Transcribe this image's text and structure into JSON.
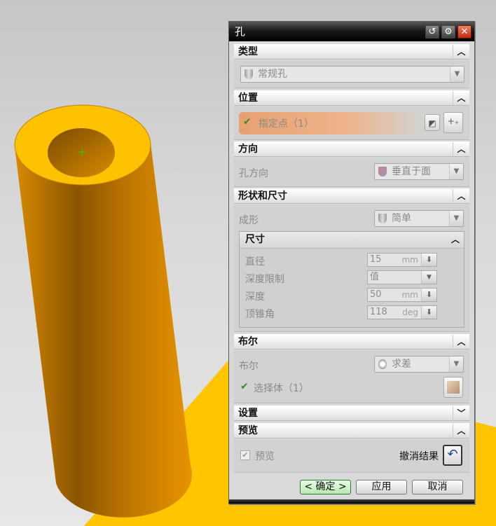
{
  "dialog": {
    "title": "孔",
    "title_buttons": {
      "reset_icon": "reset-icon",
      "settings_icon": "gear-icon",
      "close_icon": "close-icon"
    }
  },
  "sections": {
    "type": {
      "header": "类型",
      "value": "常规孔"
    },
    "position": {
      "header": "位置",
      "specify_point": "指定点（1）"
    },
    "direction": {
      "header": "方向",
      "label": "孔方向",
      "value": "垂直于面"
    },
    "shape": {
      "header": "形状和尺寸",
      "form_label": "成形",
      "form_value": "简单",
      "dims": {
        "header": "尺寸",
        "diameter_label": "直径",
        "diameter_value": "15",
        "diameter_unit": "mm",
        "depth_limit_label": "深度限制",
        "depth_limit_value": "值",
        "depth_label": "深度",
        "depth_value": "50",
        "depth_unit": "mm",
        "tip_angle_label": "顶锥角",
        "tip_angle_value": "118",
        "tip_angle_unit": "deg"
      }
    },
    "boolean": {
      "header": "布尔",
      "label": "布尔",
      "value": "求差",
      "select_body": "选择体（1）"
    },
    "settings": {
      "header": "设置"
    },
    "preview": {
      "header": "预览",
      "checkbox_label": "预览",
      "undo_label": "撤消结果"
    }
  },
  "footer": {
    "ok": "< 确定 >",
    "apply": "应用",
    "cancel": "取消"
  },
  "colors": {
    "cylinder": "#f5b800",
    "floor": "#ffc600",
    "accent_orange": "#e8a070"
  }
}
